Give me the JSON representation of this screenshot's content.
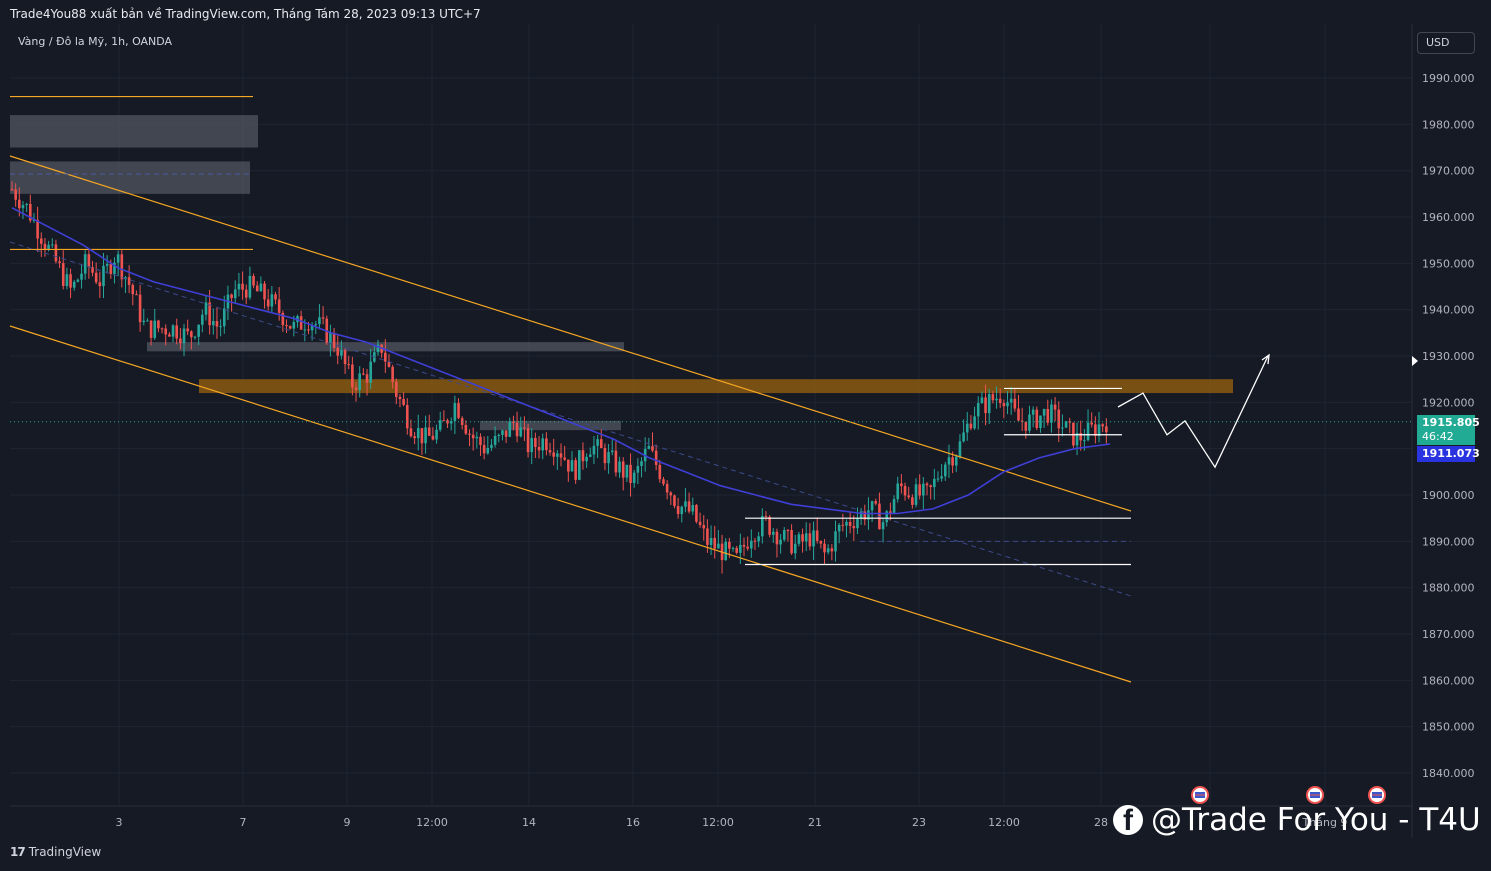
{
  "header": {
    "publish_line": "Trade4You88 xuất bản về TradingView.com, Tháng Tám 28, 2023 09:13 UTC+7",
    "symbol_line": "Vàng / Đô la Mỹ, 1h, OANDA",
    "currency_button": "USD"
  },
  "price_axis": {
    "labels": [
      "1990.000",
      "1980.000",
      "1970.000",
      "1960.000",
      "1950.000",
      "1940.000",
      "1930.000",
      "1920.000",
      "1900.000",
      "1890.000",
      "1880.000",
      "1870.000",
      "1860.000",
      "1850.000",
      "1840.000"
    ],
    "last_price": "1915.805",
    "countdown": "46:42",
    "ma_value": "1911.073",
    "last_price_color": "#22ab94",
    "ma_color": "#2934e0"
  },
  "time_axis": {
    "labels": [
      "3",
      "7",
      "9",
      "12:00",
      "14",
      "16",
      "12:00",
      "21",
      "23",
      "12:00",
      "28"
    ],
    "overlapped_labels": [
      "Tháng 9"
    ]
  },
  "branding": {
    "tv_mark": "17",
    "tv_text": "TradingView",
    "watermark_text": "@Trade For You - T4U",
    "facebook_icon": "facebook-icon"
  },
  "chart_data": {
    "type": "candlestick",
    "title": "",
    "symbol": "XAUUSD",
    "timeframe": "1h",
    "ylim": [
      1835,
      2000
    ],
    "y_ticks": [
      1990,
      1980,
      1970,
      1960,
      1950,
      1940,
      1930,
      1920,
      1900,
      1890,
      1880,
      1870,
      1860,
      1850,
      1840
    ],
    "grid": true,
    "candle_colors": {
      "up": "#26a69a",
      "down": "#ef5350"
    },
    "ohlc_anchor_closes": [
      1966,
      1962,
      1956,
      1950,
      1944,
      1950,
      1946,
      1952,
      1945,
      1936,
      1936,
      1936,
      1934,
      1940,
      1936,
      1944,
      1945,
      1943,
      1940,
      1936,
      1938,
      1936,
      1932,
      1924,
      1926,
      1932,
      1922,
      1915,
      1912,
      1914,
      1920,
      1913,
      1910,
      1912,
      1916,
      1910,
      1912,
      1910,
      1905,
      1911,
      1909,
      1906,
      1903,
      1910,
      1904,
      1898,
      1896,
      1890,
      1888,
      1886,
      1892,
      1894,
      1891,
      1889,
      1891,
      1887,
      1893,
      1895,
      1897,
      1894,
      1902,
      1900,
      1900,
      1907,
      1910,
      1918,
      1920,
      1922,
      1916,
      1916,
      1918,
      1915,
      1912,
      1914,
      1916
    ],
    "moving_average": [
      1962,
      1958,
      1954,
      1949,
      1946,
      1944,
      1942,
      1940,
      1938,
      1935,
      1933,
      1930,
      1927,
      1924,
      1921,
      1918,
      1915,
      1912,
      1908,
      1905,
      1902,
      1900,
      1898,
      1897,
      1896,
      1896,
      1897,
      1900,
      1905,
      1908,
      1910,
      1911
    ],
    "last_price": 1915.805,
    "ma_last": 1911.073,
    "annotations": {
      "forecast_path": [
        1919,
        1922,
        1913,
        1916,
        1906,
        1930
      ],
      "support_line_1": 1895,
      "support_line_2": 1885,
      "range_top": 1923,
      "range_bottom": 1913,
      "resistance_zone": [
        1922,
        1925
      ],
      "horizontal_orange_lines": [
        1986,
        1953
      ],
      "zones_grey": [
        [
          1975,
          1982
        ],
        [
          1965,
          1972
        ],
        [
          1931,
          1933
        ],
        [
          1914,
          1916
        ]
      ],
      "channel_upper_end": 1896,
      "channel_lower_end": 1860
    }
  }
}
